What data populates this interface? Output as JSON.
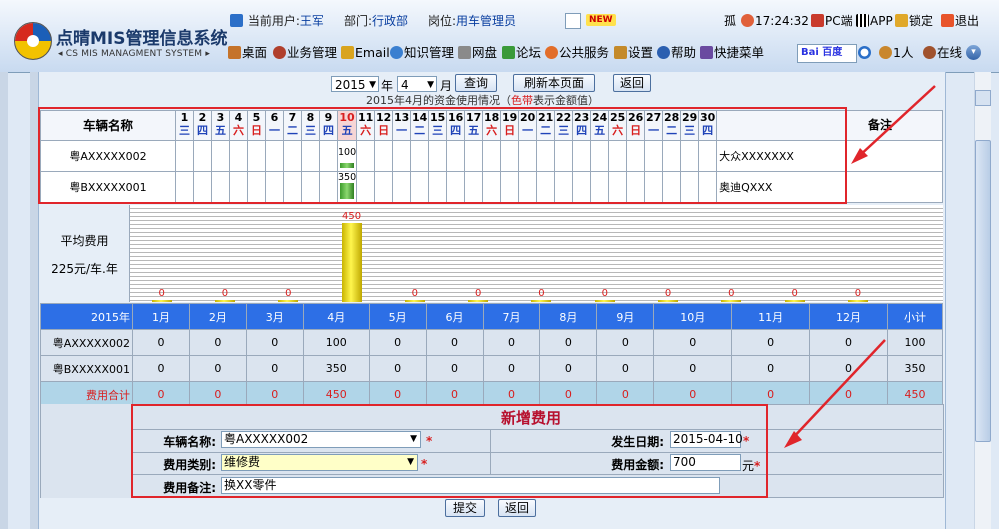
{
  "header": {
    "brand_title": "点晴MIS管理信息系统",
    "brand_subtitle": "◂ CS MIS MANAGMENT SYSTEM ▸",
    "current_user_label": "当前用户:",
    "current_user": "王军",
    "department_label": "部门:",
    "department": "行政部",
    "position_label": "岗位:",
    "position": "用车管理员",
    "new_badge": "NEW",
    "flag_text": "孤",
    "clock": "17:24:32",
    "pc_label": "PC端",
    "app_label": "APP",
    "lock_label": "锁定",
    "exit_label": "退出",
    "menu": [
      "桌面",
      "业务管理",
      "Email",
      "知识管理",
      "网盘",
      "论坛",
      "公共服务",
      "设置",
      "帮助",
      "快捷菜单"
    ],
    "search_logo": "Bai 百度",
    "online_count": "1人",
    "online_label": "在线"
  },
  "filter": {
    "year": "2015",
    "year_unit": "年",
    "month": "4",
    "month_unit": "月",
    "query_button": "查询",
    "refresh_button": "刷新本页面",
    "back_button": "返回",
    "caption_prefix": "2015年4月的资金使用情况（",
    "caption_highlight": "色带",
    "caption_suffix": "表示金额值）"
  },
  "daily_table": {
    "vehicle_header": "车辆名称",
    "notes_header": "备注",
    "days": [
      "1",
      "2",
      "3",
      "4",
      "5",
      "6",
      "7",
      "8",
      "9",
      "10",
      "11",
      "12",
      "13",
      "14",
      "15",
      "16",
      "17",
      "18",
      "19",
      "20",
      "21",
      "22",
      "23",
      "24",
      "25",
      "26",
      "27",
      "28",
      "29",
      "30"
    ],
    "weekdays": [
      "三",
      "四",
      "五",
      "六",
      "日",
      "一",
      "二",
      "三",
      "四",
      "五",
      "六",
      "日",
      "一",
      "二",
      "三",
      "四",
      "五",
      "六",
      "日",
      "一",
      "二",
      "三",
      "四",
      "五",
      "六",
      "日",
      "一",
      "二",
      "三",
      "四"
    ],
    "rows": [
      {
        "vehicle": "粤AXXXXX002",
        "day_index": 9,
        "amount": "100",
        "note": "大众XXXXXXX"
      },
      {
        "vehicle": "粤BXXXXX001",
        "day_index": 9,
        "amount": "350",
        "note": "奥迪QXXX"
      }
    ]
  },
  "avg_panel": {
    "label": "平均费用",
    "value": "225元/车.年"
  },
  "month_chart": {
    "values": [
      0,
      0,
      0,
      450,
      0,
      0,
      0,
      0,
      0,
      0,
      0,
      0
    ],
    "labels": [
      "0",
      "0",
      "0",
      "450",
      "0",
      "0",
      "0",
      "0",
      "0",
      "0",
      "0",
      "0"
    ],
    "max": 450
  },
  "month_table": {
    "year_label": "2015年",
    "months": [
      "1月",
      "2月",
      "3月",
      "4月",
      "5月",
      "6月",
      "7月",
      "8月",
      "9月",
      "10月",
      "11月",
      "12月"
    ],
    "subtotal_header": "小计",
    "rows": [
      {
        "vehicle": "粤AXXXXX002",
        "values": [
          "0",
          "0",
          "0",
          "100",
          "0",
          "0",
          "0",
          "0",
          "0",
          "0",
          "0",
          "0"
        ],
        "subtotal": "100"
      },
      {
        "vehicle": "粤BXXXXX001",
        "values": [
          "0",
          "0",
          "0",
          "350",
          "0",
          "0",
          "0",
          "0",
          "0",
          "0",
          "0",
          "0"
        ],
        "subtotal": "350"
      }
    ],
    "total_label": "费用合计",
    "total_values": [
      "0",
      "0",
      "0",
      "450",
      "0",
      "0",
      "0",
      "0",
      "0",
      "0",
      "0",
      "0"
    ],
    "total_subtotal": "450"
  },
  "form": {
    "title": "新增费用",
    "vehicle_label": "车辆名称:",
    "vehicle_value": "粤AXXXXX002",
    "date_label": "发生日期:",
    "date_value": "2015-04-10",
    "category_label": "费用类别:",
    "category_value": "维修费",
    "amount_label": "费用金额:",
    "amount_value": "700",
    "amount_unit": "元",
    "note_label": "费用备注:",
    "note_value": "换XX零件",
    "required_mark": "*",
    "submit_button": "提交",
    "back_button": "返回"
  },
  "colors": {
    "highlight_red": "#e0252b",
    "header_blue": "#2d6fe6",
    "bar_green": "#3c9b2c",
    "bar_yellow": "#fff64d"
  }
}
